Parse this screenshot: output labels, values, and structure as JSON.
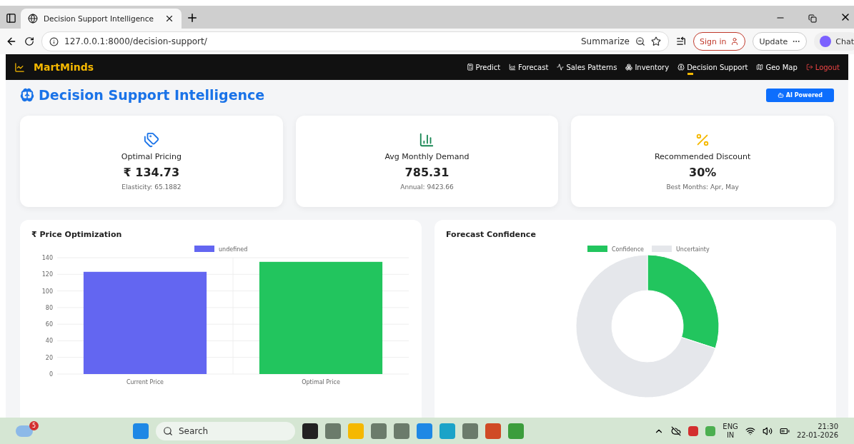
{
  "browser": {
    "tab_title": "Decision Support Intelligence",
    "address": "127.0.0.1:8000/decision-support/",
    "summarize": "Summarize",
    "sign_in": "Sign in",
    "update": "Update",
    "chat": "Chat"
  },
  "navbar": {
    "brand": "MartMinds",
    "items": [
      {
        "label": "Predict",
        "kind": "link",
        "selected": false
      },
      {
        "label": "Forecast",
        "kind": "link",
        "selected": false
      },
      {
        "label": "Sales Patterns",
        "kind": "link",
        "selected": false
      },
      {
        "label": "Inventory",
        "kind": "link",
        "selected": false
      },
      {
        "label": "Decision Support",
        "kind": "link",
        "selected": true
      },
      {
        "label": "Geo Map",
        "kind": "link",
        "selected": false
      },
      {
        "label": "Logout",
        "kind": "logout",
        "selected": false
      }
    ]
  },
  "page": {
    "title": "Decision Support Intelligence",
    "badge": "AI Powered"
  },
  "stats": [
    {
      "color": "#1a73e8",
      "label": "Optimal Pricing",
      "value": "₹ 134.73",
      "note": "Elasticity: 65.1882"
    },
    {
      "color": "#198754",
      "label": "Avg Monthly Demand",
      "value": "785.31",
      "note": "Annual: 9423.66"
    },
    {
      "color": "#f5b800",
      "label": "Recommended Discount",
      "value": "30%",
      "note": "Best Months: Apr, May"
    }
  ],
  "charts": [
    {
      "title": "₹ Price Optimization",
      "chart_data": {
        "type": "bar",
        "categories": [
          "Current Price",
          "Optimal Price"
        ],
        "series": [
          {
            "name": "undefined",
            "values": [
              123,
              135
            ]
          }
        ],
        "colors": [
          "#6366f1",
          "#22c55e"
        ],
        "ylim": [
          0,
          140
        ],
        "yticks": [
          0,
          20,
          40,
          60,
          80,
          100,
          120,
          140
        ],
        "grid": true,
        "legend": "top"
      }
    },
    {
      "title": "Forecast Confidence",
      "chart_data": {
        "type": "donut",
        "categories": [
          "Confidence",
          "Uncertainty"
        ],
        "values": [
          30,
          70
        ],
        "colors": [
          "#22c55e",
          "#e5e7eb"
        ],
        "legend": "top"
      }
    }
  ],
  "taskbar": {
    "weather_badge": "5",
    "search": "Search",
    "lang": "ENG",
    "region": "IN",
    "time": "21:30",
    "date": "22-01-2026"
  }
}
